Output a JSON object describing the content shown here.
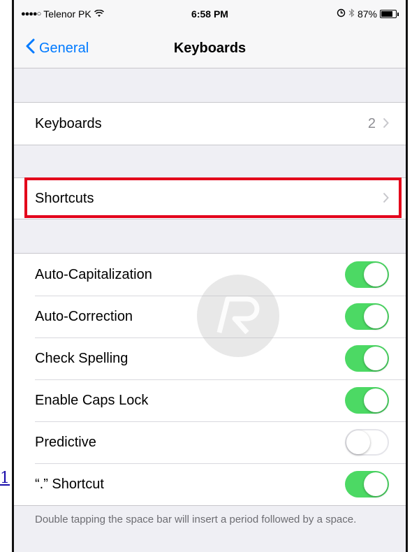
{
  "page_link": "1",
  "status_bar": {
    "carrier": "Telenor PK",
    "signal_dots": "●●●●○",
    "time": "6:58 PM",
    "battery_percent": "87%"
  },
  "nav": {
    "back_label": "General",
    "title": "Keyboards"
  },
  "keyboards_row": {
    "label": "Keyboards",
    "value": "2"
  },
  "shortcuts_row": {
    "label": "Shortcuts"
  },
  "toggles": [
    {
      "label": "Auto-Capitalization",
      "on": true
    },
    {
      "label": "Auto-Correction",
      "on": true
    },
    {
      "label": "Check Spelling",
      "on": true
    },
    {
      "label": "Enable Caps Lock",
      "on": true
    },
    {
      "label": "Predictive",
      "on": false
    },
    {
      "label": "“.” Shortcut",
      "on": true
    }
  ],
  "footer_note": "Double tapping the space bar will insert a period followed by a space.",
  "colors": {
    "accent": "#007aff",
    "toggle_on": "#4cd964",
    "highlight": "#e3001b"
  },
  "icons": [
    "wifi-icon",
    "alarm-icon",
    "bluetooth-icon",
    "battery-icon",
    "back-chevron-icon",
    "chevron-right-icon",
    "watermark-logo"
  ]
}
